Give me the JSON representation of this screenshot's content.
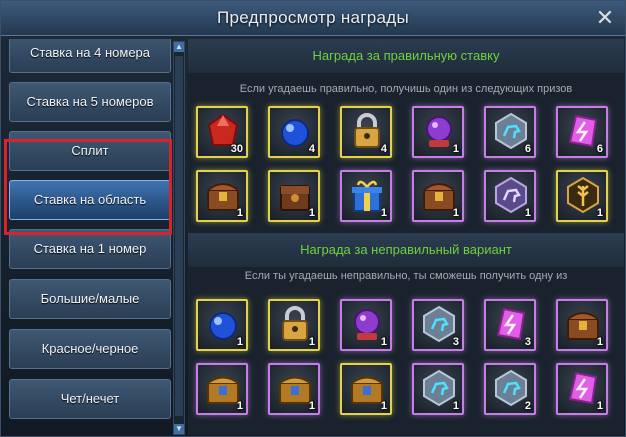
{
  "window": {
    "title": "Предпросмотр награды"
  },
  "sidebar": {
    "tabs": [
      {
        "label": "Ставка на 4 номера",
        "selected": false
      },
      {
        "label": "Ставка на 5 номеров",
        "selected": false
      },
      {
        "label": "Сплит",
        "selected": false
      },
      {
        "label": "Ставка на область",
        "selected": true
      },
      {
        "label": "Ставка на 1 номер",
        "selected": false
      },
      {
        "label": "Большие/малые",
        "selected": false
      },
      {
        "label": "Красное/черное",
        "selected": false
      },
      {
        "label": "Чет/нечет",
        "selected": false
      }
    ]
  },
  "correct": {
    "title": "Награда за правильную ставку",
    "subtitle": "Если угадаешь правильно, получишь один из следующих призов",
    "items": [
      {
        "icon": "red-gem-icon",
        "count": "30",
        "rarity": "gold"
      },
      {
        "icon": "blue-orb-icon",
        "count": "4",
        "rarity": "gold"
      },
      {
        "icon": "padlock-icon",
        "count": "4",
        "rarity": "gold"
      },
      {
        "icon": "crystal-ball-icon",
        "count": "1",
        "rarity": "purple"
      },
      {
        "icon": "horse-medal-icon",
        "count": "6",
        "rarity": "purple"
      },
      {
        "icon": "pink-rune-crystal-icon",
        "count": "6",
        "rarity": "purple"
      },
      {
        "icon": "treasure-chest-icon",
        "count": "1",
        "rarity": "gold"
      },
      {
        "icon": "wooden-chest-icon",
        "count": "1",
        "rarity": "gold"
      },
      {
        "icon": "gift-box-icon",
        "count": "1",
        "rarity": "purple"
      },
      {
        "icon": "treasure-chest-icon",
        "count": "1",
        "rarity": "purple"
      },
      {
        "icon": "horse-medal-purple-icon",
        "count": "1",
        "rarity": "purple"
      },
      {
        "icon": "wheat-medal-icon",
        "count": "1",
        "rarity": "gold"
      }
    ]
  },
  "wrong": {
    "title": "Награда за неправильный вариант",
    "subtitle": "Если ты угадаешь неправильно, ты сможешь получить одну из",
    "items": [
      {
        "icon": "blue-orb-icon",
        "count": "1",
        "rarity": "gold"
      },
      {
        "icon": "padlock-icon",
        "count": "1",
        "rarity": "gold"
      },
      {
        "icon": "crystal-ball-icon",
        "count": "1",
        "rarity": "purple"
      },
      {
        "icon": "horse-medal-icon",
        "count": "3",
        "rarity": "purple"
      },
      {
        "icon": "pink-rune-crystal-icon",
        "count": "3",
        "rarity": "purple"
      },
      {
        "icon": "treasure-chest-icon",
        "count": "1",
        "rarity": "purple"
      },
      {
        "icon": "golden-chest-icon",
        "count": "1",
        "rarity": "purple"
      },
      {
        "icon": "golden-chest-icon",
        "count": "1",
        "rarity": "purple"
      },
      {
        "icon": "golden-chest-icon",
        "count": "1",
        "rarity": "gold"
      },
      {
        "icon": "horse-medal-icon",
        "count": "1",
        "rarity": "purple"
      },
      {
        "icon": "horse-medal-icon",
        "count": "2",
        "rarity": "purple"
      },
      {
        "icon": "pink-rune-crystal-icon",
        "count": "1",
        "rarity": "purple"
      }
    ]
  },
  "colors": {
    "section_title": "#6ed23b",
    "gold_border": "#e4d34a",
    "purple_border": "#c580e6",
    "selected_frame": "#d5242b"
  }
}
